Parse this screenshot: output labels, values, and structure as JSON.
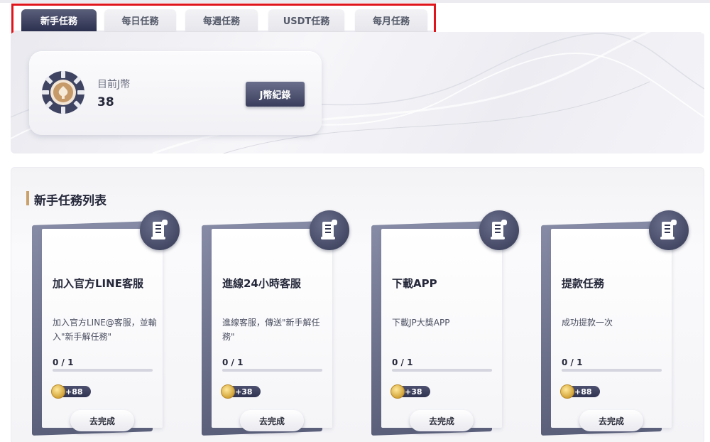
{
  "tabs": [
    {
      "label": "新手任務",
      "active": true
    },
    {
      "label": "每日任務",
      "active": false
    },
    {
      "label": "每週任務",
      "active": false
    },
    {
      "label": "USDT任務",
      "active": false
    },
    {
      "label": "每月任務",
      "active": false
    }
  ],
  "balance": {
    "label": "目前J幣",
    "value": "38",
    "button_label": "J幣紀錄"
  },
  "section": {
    "title": "新手任務列表"
  },
  "tasks": [
    {
      "title": "加入官方LINE客服",
      "desc": "加入官方LINE@客服，並輸入\"新手解任務\"",
      "progress": "0 / 1",
      "progress_fraction": 0,
      "reward": "+88",
      "button": "去完成"
    },
    {
      "title": "進線24小時客服",
      "desc": "進線客服，傳送\"新手解任務\"",
      "progress": "0 / 1",
      "progress_fraction": 0,
      "reward": "+38",
      "button": "去完成"
    },
    {
      "title": "下載APP",
      "desc": "下載JP大獎APP",
      "progress": "0 / 1",
      "progress_fraction": 0,
      "reward": "+38",
      "button": "去完成"
    },
    {
      "title": "提款任務",
      "desc": "成功提款一次",
      "progress": "0 / 1",
      "progress_fraction": 0,
      "reward": "+88",
      "button": "去完成"
    }
  ],
  "icons": {
    "balance_badge": "coin-medal-icon",
    "task_icon": "scroll-task-icon",
    "reward_icon": "gold-coin-icon"
  },
  "colors": {
    "accent_dark": "#3a3e5c",
    "highlight_outline": "#e0141b",
    "section_bar": "#c9a16a"
  }
}
